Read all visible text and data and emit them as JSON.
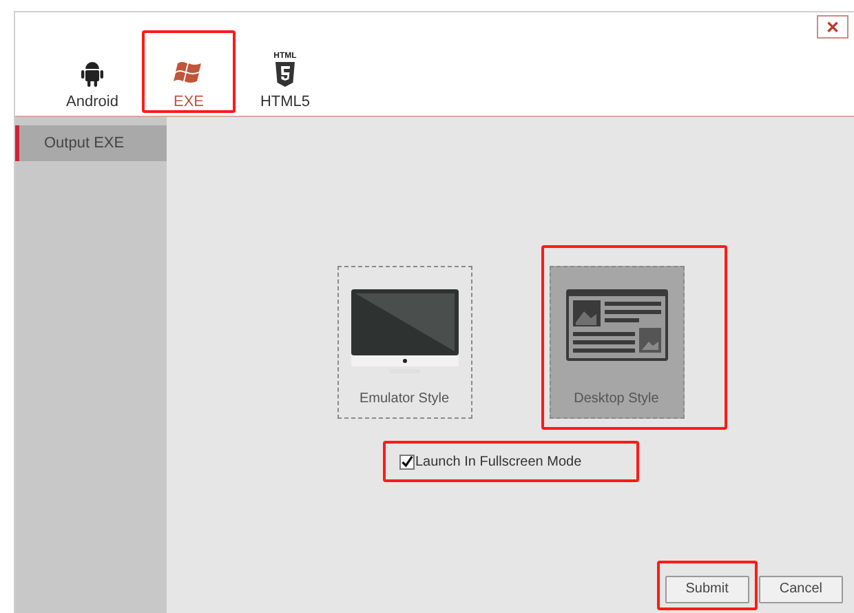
{
  "close_button": {
    "label": "✕"
  },
  "tabs": [
    {
      "label": "Android",
      "kind": "android",
      "selected": false,
      "highlighted": false
    },
    {
      "label": "EXE",
      "kind": "windows",
      "selected": true,
      "highlighted": true
    },
    {
      "label": "HTML5",
      "kind": "html5",
      "selected": false,
      "highlighted": false
    }
  ],
  "html5_icon_caption": "HTML",
  "sidebar": {
    "items": [
      {
        "label": "Output EXE",
        "selected": true
      }
    ]
  },
  "styles": [
    {
      "label": "Emulator Style",
      "kind": "monitor",
      "selected": false,
      "highlighted": false
    },
    {
      "label": "Desktop Style",
      "kind": "layout",
      "selected": true,
      "highlighted": true
    }
  ],
  "fullscreen": {
    "label": "Launch In Fullscreen Mode",
    "checked": true,
    "highlighted": true
  },
  "buttons": [
    {
      "label": "Submit",
      "highlighted": true
    },
    {
      "label": "Cancel",
      "highlighted": false
    }
  ]
}
